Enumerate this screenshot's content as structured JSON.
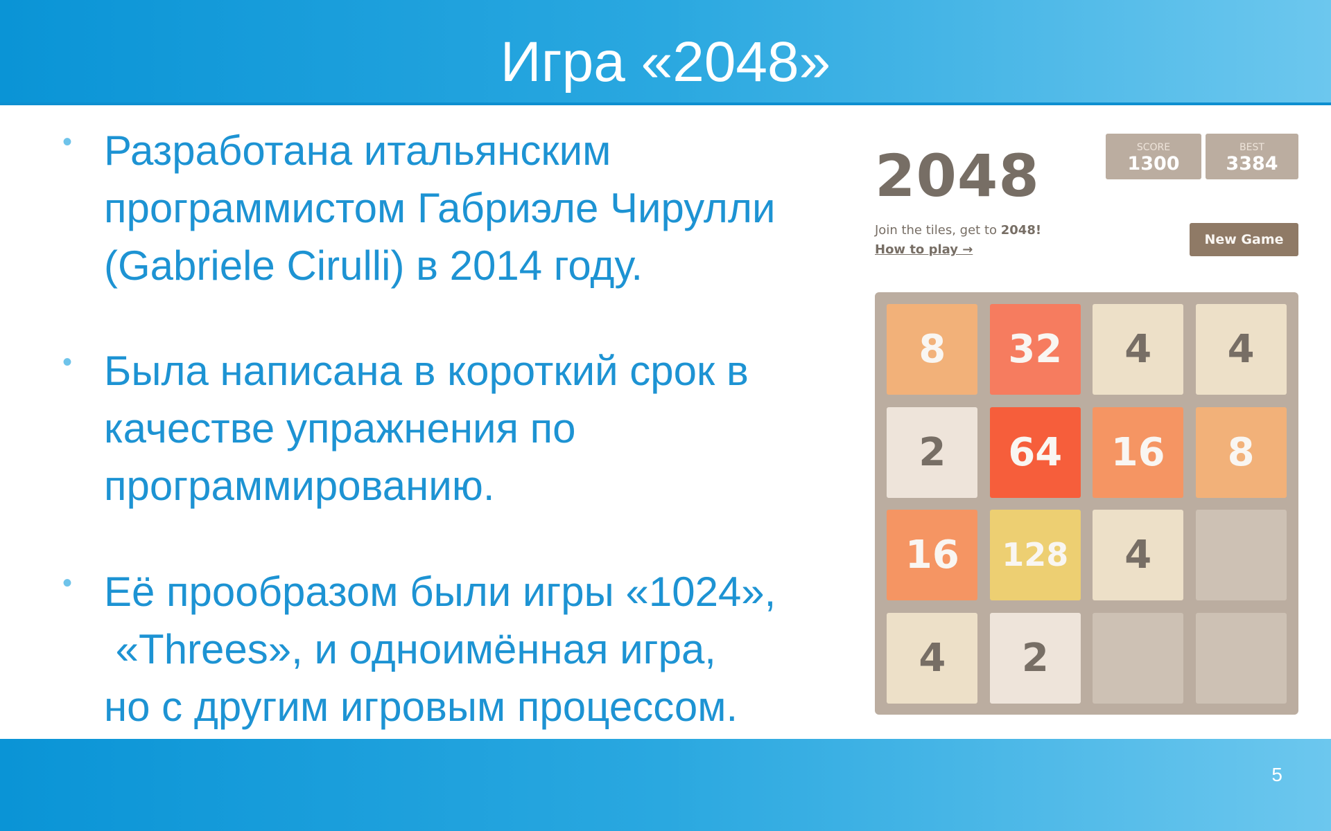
{
  "slide": {
    "title": "Игра «2048»",
    "page_number": "5",
    "bullets": [
      [
        "Разработана итальянским",
        "программистом Габриэле Чирулли",
        "(Gabriele Cirulli) в 2014 году."
      ],
      [
        "Была написана в короткий срок в",
        "качестве упражнения по",
        "программированию."
      ],
      [
        "Её прообразом были игры «1024»,",
        " «Threes», и одноимённая игра,",
        "но с другим игровым процессом."
      ]
    ],
    "bullet_symbol": "•"
  },
  "game": {
    "logo": "2048",
    "score_label": "SCORE",
    "score_value": "1300",
    "best_label": "BEST",
    "best_value": "3384",
    "intro_text": "Join the tiles, get to ",
    "intro_strong": "2048!",
    "how_to_play": "How to play →",
    "new_game_label": "New Game",
    "grid": [
      [
        "8",
        "32",
        "4",
        "4"
      ],
      [
        "2",
        "64",
        "16",
        "8"
      ],
      [
        "16",
        "128",
        "4",
        ""
      ],
      [
        "4",
        "2",
        "",
        ""
      ]
    ]
  },
  "colors": {
    "header_accent": "#0a94d6",
    "bullet_text": "#1d93d3",
    "board": "#bbada0",
    "empty_cell": "#cdc1b4"
  }
}
